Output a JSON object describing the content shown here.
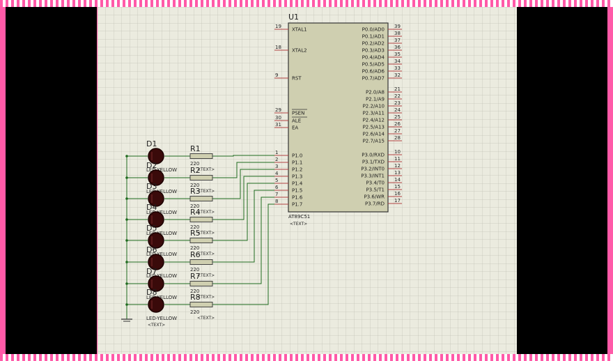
{
  "chip": {
    "ref": "U1",
    "part": "AT89C51",
    "text_placeholder": "<TEXT>",
    "left_pins": [
      {
        "num": "19",
        "name": "XTAL1"
      },
      {
        "num": "18",
        "name": "XTAL2"
      },
      {
        "num": "9",
        "name": "RST"
      },
      {
        "num": "29",
        "name": "PSEN"
      },
      {
        "num": "30",
        "name": "ALE"
      },
      {
        "num": "31",
        "name": "EA"
      },
      {
        "num": "1",
        "name": "P1.0"
      },
      {
        "num": "2",
        "name": "P1.1"
      },
      {
        "num": "3",
        "name": "P1.2"
      },
      {
        "num": "4",
        "name": "P1.3"
      },
      {
        "num": "5",
        "name": "P1.4"
      },
      {
        "num": "6",
        "name": "P1.5"
      },
      {
        "num": "7",
        "name": "P1.6"
      },
      {
        "num": "8",
        "name": "P1.7"
      }
    ],
    "right_pins": [
      {
        "num": "39",
        "name": "P0.0/AD0"
      },
      {
        "num": "38",
        "name": "P0.1/AD1"
      },
      {
        "num": "37",
        "name": "P0.2/AD2"
      },
      {
        "num": "36",
        "name": "P0.3/AD3"
      },
      {
        "num": "35",
        "name": "P0.4/AD4"
      },
      {
        "num": "34",
        "name": "P0.5/AD5"
      },
      {
        "num": "33",
        "name": "P0.6/AD6"
      },
      {
        "num": "32",
        "name": "P0.7/AD7"
      },
      {
        "num": "21",
        "name": "P2.0/A8"
      },
      {
        "num": "22",
        "name": "P2.1/A9"
      },
      {
        "num": "23",
        "name": "P2.2/A10"
      },
      {
        "num": "24",
        "name": "P2.3/A11"
      },
      {
        "num": "25",
        "name": "P2.4/A12"
      },
      {
        "num": "26",
        "name": "P2.5/A13"
      },
      {
        "num": "27",
        "name": "P2.6/A14"
      },
      {
        "num": "28",
        "name": "P2.7/A15"
      },
      {
        "num": "10",
        "name": "P3.0/RXD"
      },
      {
        "num": "11",
        "name": "P3.1/TXD"
      },
      {
        "num": "12",
        "name": "P3.2/INT0"
      },
      {
        "num": "13",
        "name": "P3.3/INT1"
      },
      {
        "num": "14",
        "name": "P3.4/T0"
      },
      {
        "num": "15",
        "name": "P3.5/T1"
      },
      {
        "num": "16",
        "name": "P3.6/WR"
      },
      {
        "num": "17",
        "name": "P3.7/RD"
      }
    ]
  },
  "leds": [
    {
      "ref": "D1",
      "part": "LED-YELLOW"
    },
    {
      "ref": "D2",
      "part": "LED-YELLOW"
    },
    {
      "ref": "D3",
      "part": "LED-YELLOW"
    },
    {
      "ref": "D4",
      "part": "LED-YELLOW"
    },
    {
      "ref": "D5",
      "part": "LED-YELLOW"
    },
    {
      "ref": "D6",
      "part": "LED-YELLOW"
    },
    {
      "ref": "D7",
      "part": "LED-YELLOW"
    },
    {
      "ref": "D8",
      "part": "LED-YELLOW"
    }
  ],
  "resistors": [
    {
      "ref": "R1",
      "value": "220"
    },
    {
      "ref": "R2",
      "value": "220"
    },
    {
      "ref": "R3",
      "value": "220"
    },
    {
      "ref": "R4",
      "value": "220"
    },
    {
      "ref": "R5",
      "value": "220"
    },
    {
      "ref": "R6",
      "value": "220"
    },
    {
      "ref": "R7",
      "value": "220"
    },
    {
      "ref": "R8",
      "value": "220"
    }
  ],
  "text_placeholder": "<TEXT>",
  "colors": {
    "canvas": "#ebebdf",
    "grid": "#c4c4b8",
    "chip_fill": "#cfcfb0",
    "chip_border": "#333333",
    "wire": "#1f6b1f",
    "pin": "#b04040",
    "led_fill": "#3a0a0a",
    "led_border": "#1a0000",
    "resistor_fill": "#cfcfb0"
  }
}
